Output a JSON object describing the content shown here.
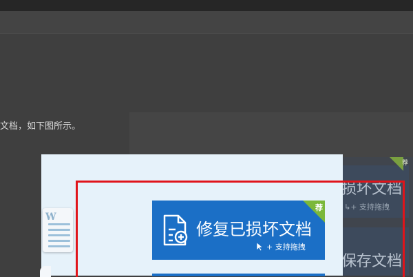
{
  "article": {
    "text": "文档，如下图所示。"
  },
  "right_panel": {
    "button1_label": "损坏文档",
    "button1_sub": "↳+ 支持拖拽",
    "button2_label": "保存文档",
    "badge": "荐"
  },
  "dialog": {
    "repair_button": {
      "label": "修复已损坏文档",
      "drag_hint": "+ 支持拖拽",
      "badge": "荐"
    },
    "doc_icon_letter": "W"
  },
  "colors": {
    "dialog_bg": "#e6f2fa",
    "button_blue": "#1b6fc6",
    "badge_green": "#7bb83a",
    "highlight_red": "#e0141a"
  }
}
